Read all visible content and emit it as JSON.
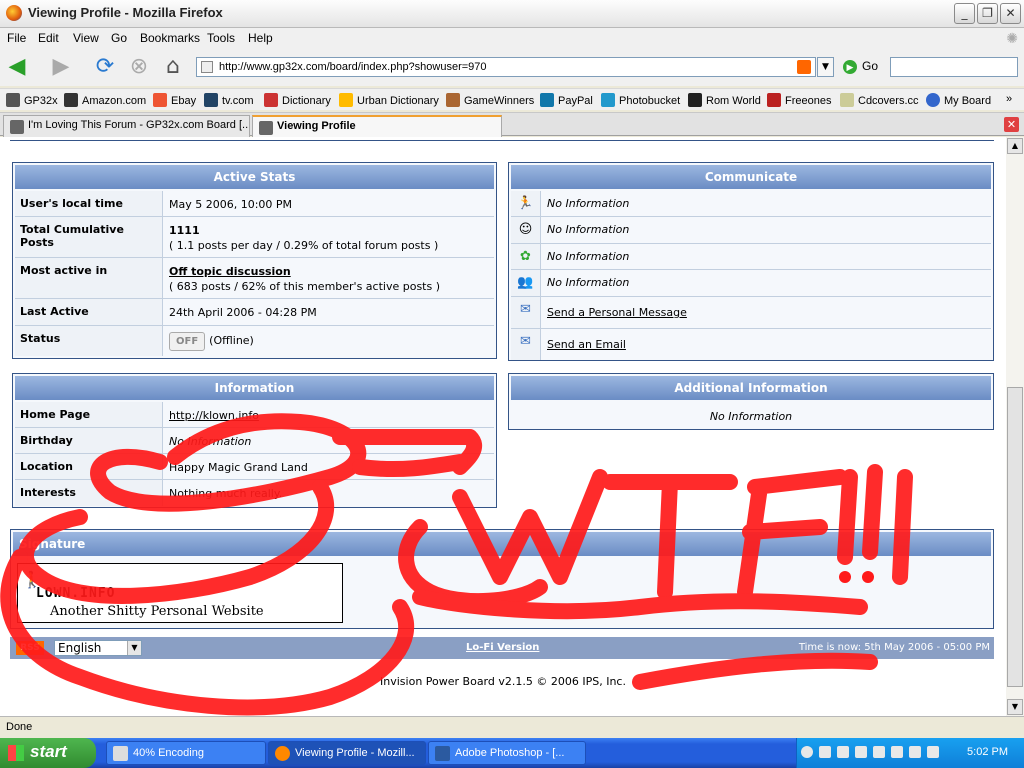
{
  "window": {
    "title": "Viewing Profile - Mozilla Firefox"
  },
  "menu": [
    "File",
    "Edit",
    "View",
    "Go",
    "Bookmarks",
    "Tools",
    "Help"
  ],
  "url": "http://www.gp32x.com/board/index.php?showuser=970",
  "go_label": "Go",
  "bookmarks": [
    "GP32x",
    "Amazon.com",
    "Ebay",
    "tv.com",
    "Dictionary",
    "Urban Dictionary",
    "GameWinners",
    "PayPal",
    "Photobucket",
    "Rom World",
    "Freeones",
    "Cdcovers.cc",
    "My Board"
  ],
  "tabs": [
    {
      "label": "I'm Loving This Forum - GP32x.com Board [..."
    },
    {
      "label": "Viewing Profile"
    }
  ],
  "active_stats": {
    "title": "Active Stats",
    "local_time_label": "User's local time",
    "local_time": "May 5 2006, 10:00 PM",
    "posts_label": "Total Cumulative Posts",
    "posts": "1111",
    "posts_sub": "( 1.1 posts per day / 0.29% of total forum posts )",
    "active_in_label": "Most active in",
    "active_in": "Off topic discussion",
    "active_in_sub": "( 683 posts / 62% of this member's active posts )",
    "last_active_label": "Last Active",
    "last_active": "24th April 2006 - 04:28 PM",
    "status_label": "Status",
    "status_badge": "OFF",
    "status_text": "(Offline)"
  },
  "communicate": {
    "title": "Communicate",
    "no_info": "No Information",
    "pm": "Send a Personal Message",
    "email": "Send an Email"
  },
  "information": {
    "title": "Information",
    "homepage_label": "Home Page",
    "homepage": "http://klown.info",
    "birthday_label": "Birthday",
    "birthday": "No Information",
    "location_label": "Location",
    "location": "Happy Magic Grand Land",
    "interests_label": "Interests",
    "interests": "Nothing much really."
  },
  "additional": {
    "title": "Additional Information",
    "value": "No Information"
  },
  "signature": {
    "title": "Signature",
    "line1": "LOWN.INFO",
    "line2": "Another Shitty Personal Website"
  },
  "footer": {
    "rss": "RSS",
    "language": "English",
    "lofi": "Lo-Fi Version",
    "time_now": "Time is now: 5th May 2006 - 05:00 PM"
  },
  "copyright": "Invision Power Board v2.1.5 © 2006  IPS, Inc.",
  "status": "Done",
  "taskbar": {
    "start": "start",
    "tasks": [
      "40% Encoding",
      "Viewing Profile - Mozill...",
      "Adobe Photoshop - [..."
    ],
    "clock": "5:02 PM"
  },
  "scribble_color": "#ff1a1a"
}
